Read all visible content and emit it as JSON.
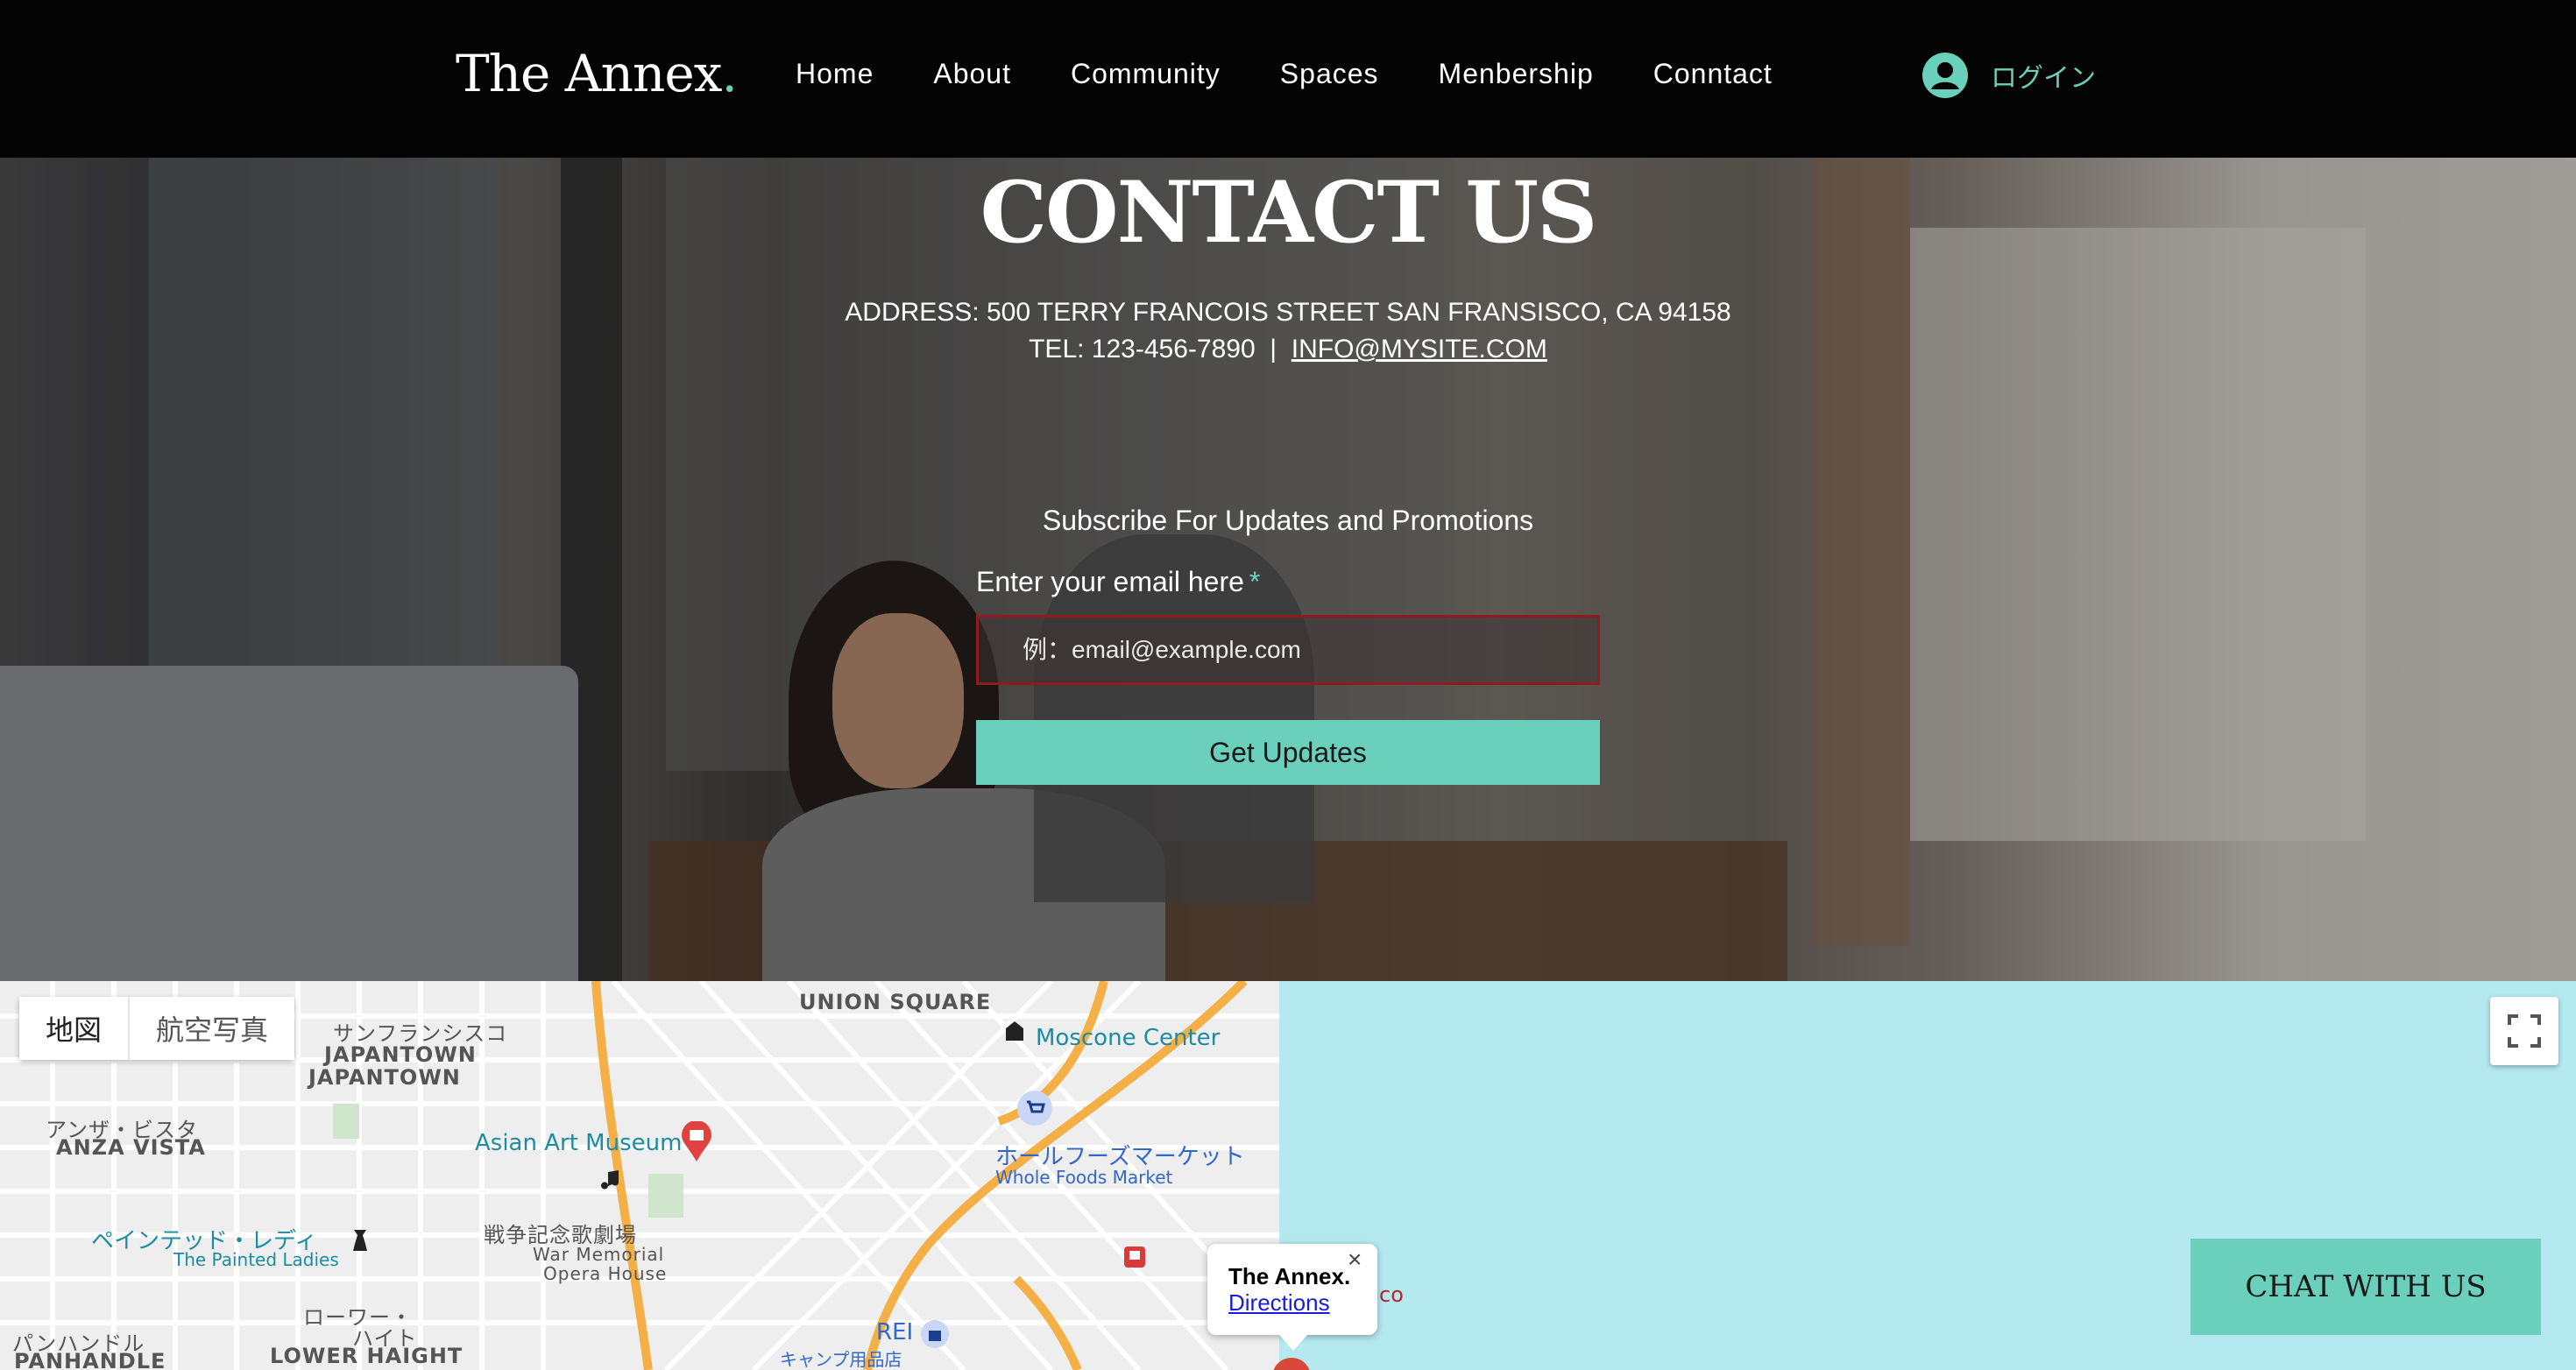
{
  "brand": {
    "name": "The Annex",
    "dot": ".",
    "accent_color": "#6acfbb"
  },
  "nav": {
    "items": [
      "Home",
      "About",
      "Community",
      "Spaces",
      "Menbership",
      "Conntact"
    ]
  },
  "login": {
    "icon": "user-avatar-icon",
    "label": "ログイン"
  },
  "hero": {
    "title": "CONTACT US",
    "address": "ADDRESS: 500 TERRY FRANCOIS STREET SAN FRANSISCO, CA 94158",
    "tel": "TEL: 123-456-7890",
    "separator": "|",
    "email": "INFO@MYSITE.COM"
  },
  "subscribe": {
    "heading": "Subscribe For Updates and Promotions",
    "field_label": "Enter your email here",
    "required_mark": "*",
    "placeholder": "例：email@example.com",
    "button_label": "Get Updates"
  },
  "map": {
    "type_buttons": [
      "地図",
      "航空写真"
    ],
    "fullscreen_icon": "fullscreen-icon",
    "labels": {
      "union_square": "UNION SQUARE",
      "moscone": "Moscone Center",
      "sf_jp": "サンフランシスコ",
      "japantown_jp": "JAPANTOWN",
      "japantown": "JAPANTOWN",
      "anza_jp": "アンザ・ビスタ",
      "anza": "ANZA VISTA",
      "asian_art": "Asian Art Museum",
      "wholefoods_jp": "ホールフーズマーケット",
      "wholefoods": "Whole Foods Market",
      "painted_jp": "ペインテッド・レディ",
      "painted": "The Painted Ladies",
      "war_jp": "戦争記念歌劇場",
      "war_en1": "War Memorial",
      "war_en2": "Opera House",
      "lower_jp1": "ローワー・",
      "lower_jp2": "ハイト",
      "lower": "LOWER HAIGHT",
      "panhandle_jp": "パンハンドル",
      "panhandle": "PANHANDLE",
      "rei": "REI",
      "camp_jp": "キャンプ用品店",
      "co_fragment": "co"
    },
    "info_window": {
      "title": "The Annex.",
      "link": "Directions",
      "close": "×"
    }
  },
  "chat": {
    "label": "CHAT WITH US"
  }
}
